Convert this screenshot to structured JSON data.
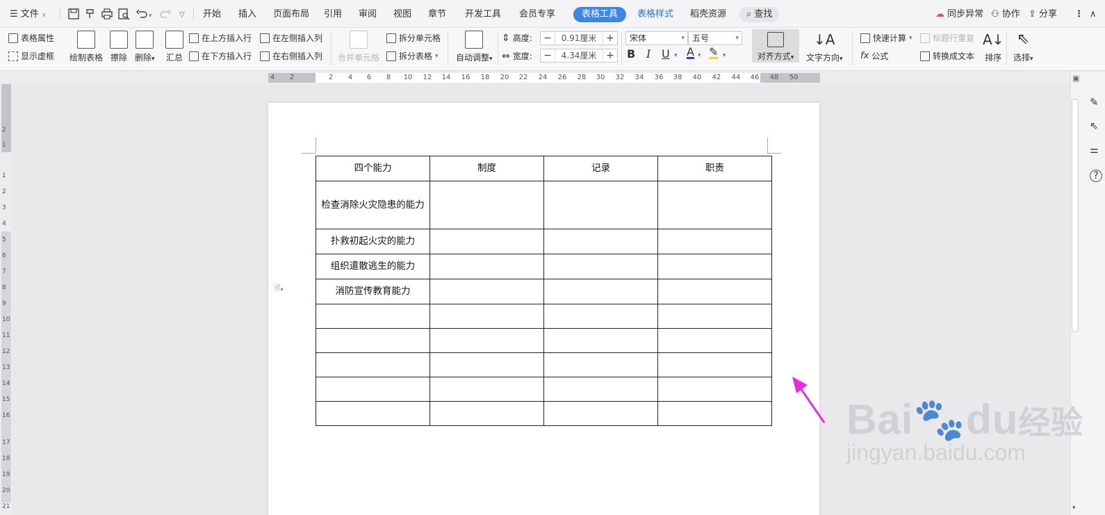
{
  "menu": {
    "file": "文件",
    "tabs": [
      "开始",
      "插入",
      "页面布局",
      "引用",
      "审阅",
      "视图",
      "章节",
      "开发工具",
      "会员专享",
      "表格工具",
      "表格样式",
      "稻壳资源"
    ],
    "active_tab": "表格工具",
    "search": "查找",
    "sync": "同步异常",
    "collab": "协作",
    "share": "分享"
  },
  "ribbon": {
    "table_props": "表格属性",
    "show_grid": "显示虚框",
    "draw_table": "绘制表格",
    "erase": "擦除",
    "delete": "删除",
    "summary": "汇总",
    "insert_above": "在上方插入行",
    "insert_below": "在下方插入行",
    "insert_left": "在左侧插入列",
    "insert_right": "在右侧插入列",
    "merge_cells": "合并单元格",
    "split_cells": "拆分单元格",
    "split_table": "拆分表格",
    "auto_fit": "自动调整",
    "height_label": "高度:",
    "height_value": "0.91厘米",
    "width_label": "宽度:",
    "width_value": "4.34厘米",
    "font_name": "宋体",
    "font_size": "五号",
    "align": "对齐方式",
    "text_direction": "文字方向",
    "quick_calc": "快速计算",
    "repeat_header": "标题行重复",
    "formula": "公式",
    "to_text": "转换成文本",
    "sort": "排序",
    "select": "选择"
  },
  "ruler": {
    "h_ticks": [
      "4",
      "2",
      "2",
      "4",
      "6",
      "8",
      "10",
      "12",
      "14",
      "16",
      "18",
      "20",
      "22",
      "24",
      "26",
      "28",
      "30",
      "32",
      "34",
      "36",
      "38",
      "40",
      "42",
      "44",
      "46",
      "48",
      "50"
    ],
    "v_ticks": [
      "2",
      "1",
      "1",
      "2",
      "3",
      "4",
      "5",
      "6",
      "7",
      "8",
      "9",
      "10",
      "11",
      "12",
      "13",
      "14",
      "15",
      "16",
      "17",
      "18",
      "19",
      "20",
      "21",
      "22"
    ]
  },
  "table": {
    "headers": [
      "四个能力",
      "制度",
      "记录",
      "职责"
    ],
    "rows": [
      [
        "检查消除火灾隐患的能力",
        "",
        "",
        ""
      ],
      [
        "扑救初起火灾的能力",
        "",
        "",
        ""
      ],
      [
        "组织遣散逃生的能力",
        "",
        "",
        ""
      ],
      [
        "消防宣传教育能力",
        "",
        "",
        ""
      ],
      [
        "",
        "",
        "",
        ""
      ],
      [
        "",
        "",
        "",
        ""
      ],
      [
        "",
        "",
        "",
        ""
      ],
      [
        "",
        "",
        "",
        ""
      ],
      [
        "",
        "",
        "",
        ""
      ]
    ]
  },
  "watermark": {
    "brand": "Bai",
    "brand2": "du",
    "cn": "经验",
    "url": "jingyan.baidu.com"
  },
  "colors": {
    "accent": "#3a87e8",
    "arrow": "#e62ee0"
  }
}
